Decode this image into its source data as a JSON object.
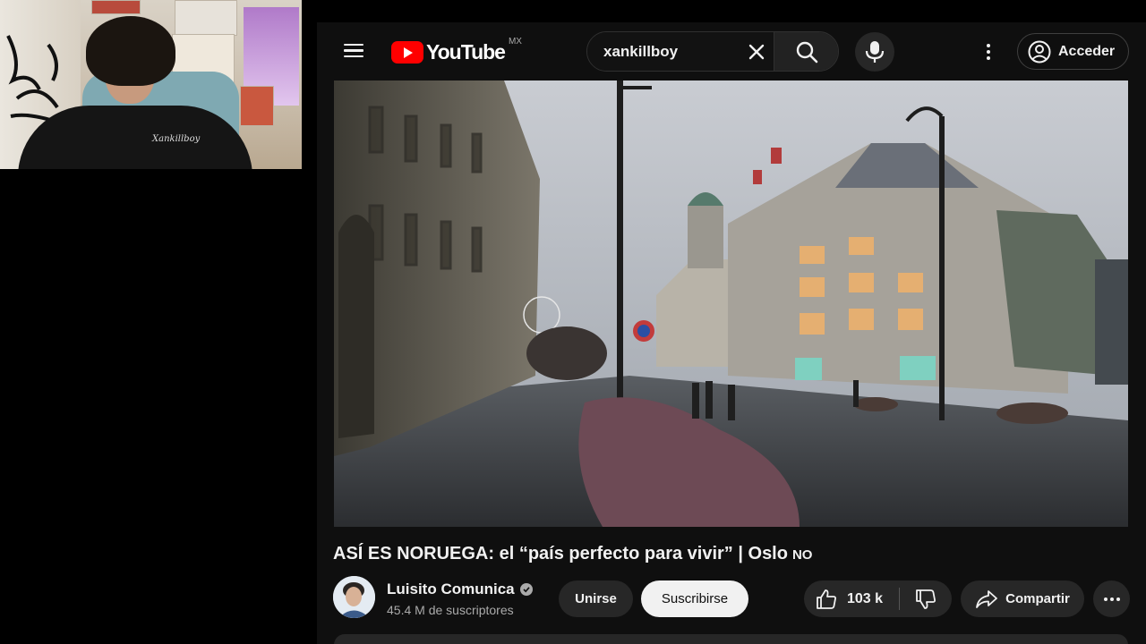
{
  "webcam": {
    "shirt_text": "Xankillboy"
  },
  "header": {
    "logo_text": "YouTube",
    "region": "MX",
    "search_value": "xankillboy",
    "signin_label": "Acceder"
  },
  "video": {
    "title": "ASÍ ES NORUEGA: el “país perfecto para vivir” | Oslo",
    "flag": "NO"
  },
  "channel": {
    "name": "Luisito Comunica",
    "subscribers": "45.4 M de suscriptores"
  },
  "actions": {
    "join_label": "Unirse",
    "subscribe_label": "Suscribirse",
    "like_count": "103 k",
    "share_label": "Compartir"
  },
  "icons": [
    "menu-icon",
    "youtube-logo-icon",
    "clear-icon",
    "search-icon",
    "mic-icon",
    "more-vert-icon",
    "account-icon",
    "verified-icon",
    "like-icon",
    "dislike-icon",
    "share-icon",
    "more-horiz-icon"
  ],
  "colors": {
    "brand": "#ff0000",
    "background": "#0f0f0f",
    "pill": "#272727",
    "subscribe_bg": "#f1f1f1"
  }
}
